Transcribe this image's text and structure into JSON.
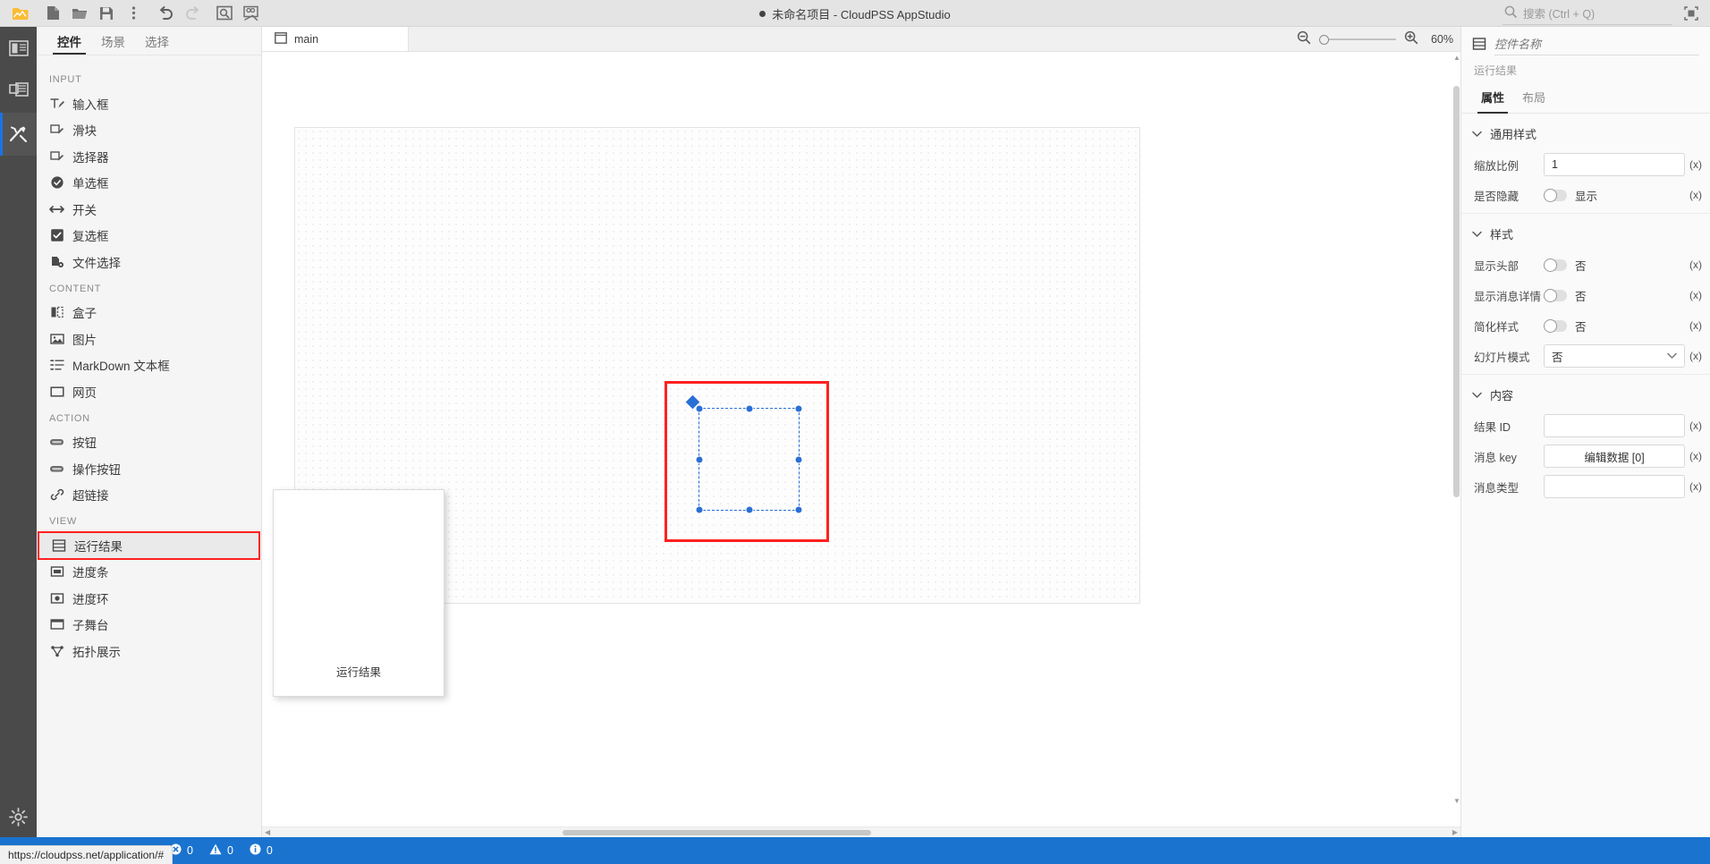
{
  "titlebar": {
    "project_title": "未命名项目 - CloudPSS AppStudio",
    "search_placeholder": "搜索 (Ctrl + Q)",
    "icons": [
      {
        "name": "app-logo-icon"
      },
      {
        "name": "new-file-icon"
      },
      {
        "name": "open-folder-icon"
      },
      {
        "name": "save-icon"
      },
      {
        "name": "more-vertical-icon"
      },
      {
        "name": "undo-icon"
      },
      {
        "name": "redo-icon"
      },
      {
        "name": "preview-icon"
      },
      {
        "name": "publish-icon"
      }
    ]
  },
  "activitybar": {
    "items": [
      {
        "name": "layout-panel-icon",
        "active": false
      },
      {
        "name": "pages-icon",
        "active": false
      },
      {
        "name": "tools-icon",
        "active": true
      }
    ],
    "settings": {
      "name": "settings-gear-icon"
    }
  },
  "leftpanel": {
    "tabs": [
      {
        "label": "控件",
        "active": true
      },
      {
        "label": "场景",
        "active": false
      },
      {
        "label": "选择",
        "active": false
      }
    ],
    "groups": [
      {
        "title": "INPUT",
        "items": [
          {
            "label": "输入框",
            "icon": "text-input-icon"
          },
          {
            "label": "滑块",
            "icon": "slider-icon"
          },
          {
            "label": "选择器",
            "icon": "select-icon"
          },
          {
            "label": "单选框",
            "icon": "radio-icon"
          },
          {
            "label": "开关",
            "icon": "switch-icon"
          },
          {
            "label": "复选框",
            "icon": "checkbox-icon"
          },
          {
            "label": "文件选择",
            "icon": "file-picker-icon"
          }
        ]
      },
      {
        "title": "CONTENT",
        "items": [
          {
            "label": "盒子",
            "icon": "box-icon"
          },
          {
            "label": "图片",
            "icon": "image-icon"
          },
          {
            "label": "MarkDown 文本框",
            "icon": "markdown-icon"
          },
          {
            "label": "网页",
            "icon": "webpage-icon"
          }
        ]
      },
      {
        "title": "ACTION",
        "items": [
          {
            "label": "按钮",
            "icon": "button-icon"
          },
          {
            "label": "操作按钮",
            "icon": "action-button-icon"
          },
          {
            "label": "超链接",
            "icon": "link-icon"
          }
        ]
      },
      {
        "title": "VIEW",
        "items": [
          {
            "label": "运行结果",
            "icon": "result-icon",
            "highlighted": true
          },
          {
            "label": "进度条",
            "icon": "progress-bar-icon"
          },
          {
            "label": "进度环",
            "icon": "progress-ring-icon"
          },
          {
            "label": "子舞台",
            "icon": "sub-stage-icon"
          },
          {
            "label": "拓扑展示",
            "icon": "topology-icon"
          }
        ]
      }
    ]
  },
  "center": {
    "tab": {
      "label": "main",
      "icon": "stage-icon"
    },
    "zoom": {
      "zoom_out_icon": "zoom-out-icon",
      "zoom_in_icon": "zoom-in-icon",
      "level": "60%"
    },
    "drag_ghost_label": "运行结果"
  },
  "rightpanel": {
    "widget_name_placeholder": "控件名称",
    "widget_name_value": "",
    "widget_type": "运行结果",
    "header_icon": "result-icon",
    "tabs": [
      {
        "label": "属性",
        "active": true
      },
      {
        "label": "布局",
        "active": false
      }
    ],
    "sections": [
      {
        "title": "通用样式",
        "rows": [
          {
            "label": "缩放比例",
            "type": "input",
            "value": "1",
            "expr": "(x)"
          },
          {
            "label": "是否隐藏",
            "type": "toggle",
            "value": "显示",
            "expr": "(x)"
          }
        ]
      },
      {
        "title": "样式",
        "rows": [
          {
            "label": "显示头部",
            "type": "toggle",
            "value": "否",
            "expr": "(x)"
          },
          {
            "label": "显示消息详情",
            "type": "toggle",
            "value": "否",
            "expr": "(x)"
          },
          {
            "label": "简化样式",
            "type": "toggle",
            "value": "否",
            "expr": "(x)"
          },
          {
            "label": "幻灯片模式",
            "type": "select",
            "value": "否",
            "expr": "(x)"
          }
        ]
      },
      {
        "title": "内容",
        "rows": [
          {
            "label": "结果 ID",
            "type": "input",
            "value": "",
            "expr": "(x)"
          },
          {
            "label": "消息 key",
            "type": "button",
            "value": "编辑数据 [0]",
            "expr": "(x)"
          },
          {
            "label": "消息类型",
            "type": "input",
            "value": "",
            "expr": "(x)"
          }
        ]
      }
    ]
  },
  "statusbar": {
    "errors": "0",
    "warnings": "0",
    "infos": "0",
    "error_icon": "error-circle-icon",
    "warning_icon": "warning-triangle-icon",
    "info_icon": "info-circle-icon",
    "url_tooltip": "https://cloudpss.net/application/#"
  },
  "colors": {
    "accent": "#1a73e8",
    "highlight": "#ff2020",
    "selection": "#2a6fd6",
    "statusbar": "#1a73cf"
  }
}
